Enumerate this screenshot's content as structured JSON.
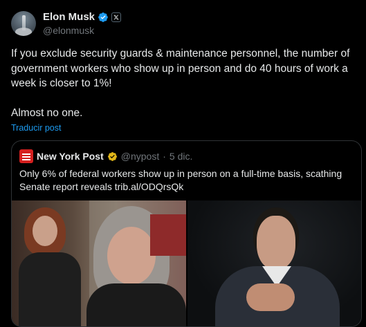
{
  "tweet": {
    "author_name": "Elon Musk",
    "author_handle": "@elonmusk",
    "text_paragraph_1": "If you exclude security guards & maintenance personnel, the number of government workers who show up in person and do 40 hours of work a week is closer to 1%!",
    "text_paragraph_2": "Almost no one.",
    "translate_label": "Traducir post"
  },
  "quoted": {
    "author_name": "New York Post",
    "author_handle": "@nypost",
    "separator": "·",
    "date": "5 dic.",
    "text": "Only 6% of federal workers show up in person on a full-time basis, scathing Senate report reveals trib.al/ODQrsQk"
  },
  "colors": {
    "background": "#000000",
    "text": "#e7e9ea",
    "muted": "#71767b",
    "link": "#1d9bf0",
    "verified_blue": "#1d9bf0",
    "verified_gold": "#e2b719",
    "nypost_red": "#d5201f"
  },
  "icons": {
    "verified": "verified-badge-icon",
    "x_affiliation": "x-logo-icon",
    "gold_check": "gold-verified-icon"
  }
}
